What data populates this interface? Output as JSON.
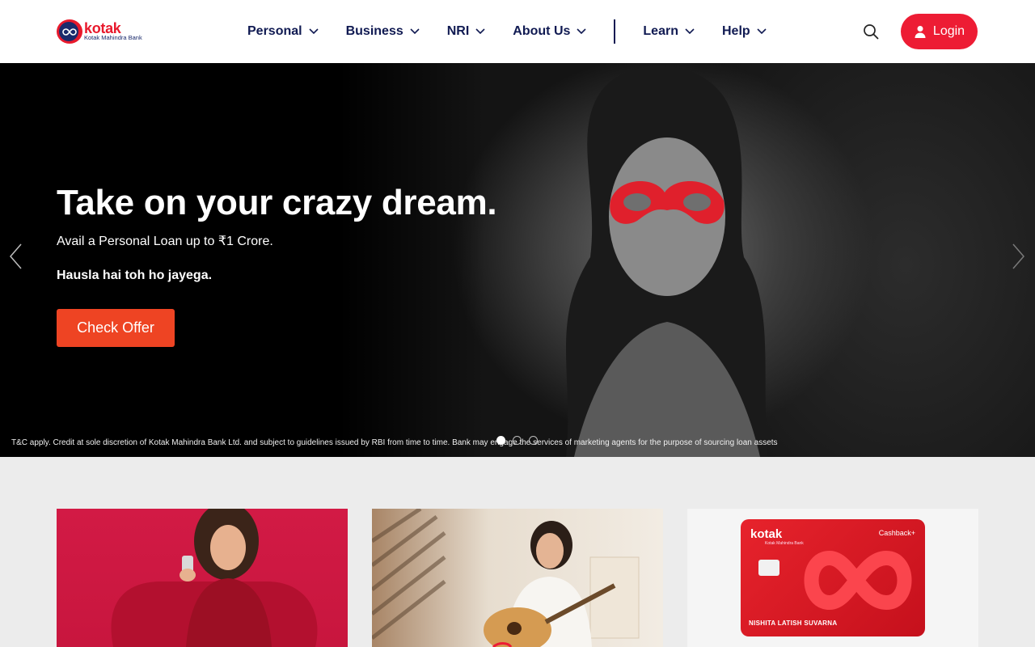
{
  "brand": {
    "name": "kotak",
    "subtitle": "Kotak Mahindra Bank"
  },
  "nav": {
    "items": [
      {
        "label": "Personal"
      },
      {
        "label": "Business"
      },
      {
        "label": "NRI"
      },
      {
        "label": "About Us"
      },
      {
        "label": "Learn"
      },
      {
        "label": "Help"
      }
    ],
    "login_label": "Login"
  },
  "hero": {
    "title": "Take on your crazy dream.",
    "subtitle": "Avail a Personal Loan up to ₹1 Crore.",
    "tagline": "Hausla hai toh ho jayega.",
    "cta_label": "Check Offer",
    "disclaimer": "T&C apply. Credit at sole discretion of Kotak Mahindra Bank Ltd. and subject to guidelines issued by RBI from time to time. Bank may engage the services of marketing agents for the purpose of sourcing loan assets",
    "slides_total": 3,
    "active_slide": 1
  },
  "cards": {
    "credit_card": {
      "brand": "kotak",
      "brand_sub": "Kotak Mahindra Bank",
      "variant": "Cashback+",
      "holder": "NISHITA LATISH SUVARNA"
    }
  },
  "colors": {
    "brand_red": "#ed1c34",
    "brand_navy": "#101a52",
    "cta_orange": "#ee4423"
  }
}
